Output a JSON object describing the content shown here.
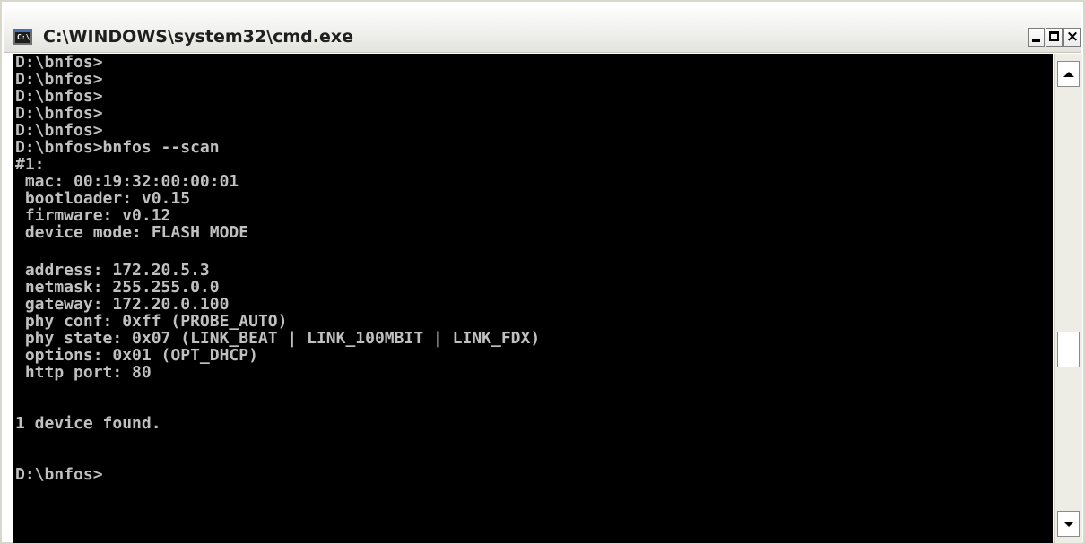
{
  "window": {
    "title": "C:\\WINDOWS\\system32\\cmd.exe",
    "icon_text": "C:\\",
    "icons": {
      "app": "cmd-icon",
      "minimize": "minimize-icon",
      "maximize": "maximize-icon",
      "close": "close-icon",
      "scroll_up": "scroll-up-arrow-icon",
      "scroll_down": "scroll-down-arrow-icon"
    },
    "close_glyph": "×"
  },
  "console": {
    "background_color": "#000000",
    "text_color": "#c0c0c0",
    "lines": [
      "D:\\bnfos>",
      "D:\\bnfos>",
      "D:\\bnfos>",
      "D:\\bnfos>",
      "D:\\bnfos>",
      "D:\\bnfos>bnfos --scan",
      "#1:",
      " mac: 00:19:32:00:00:01",
      " bootloader: v0.15",
      " firmware: v0.12",
      " device mode: FLASH MODE",
      "",
      " address: 172.20.5.3",
      " netmask: 255.255.0.0",
      " gateway: 172.20.0.100",
      " phy conf: 0xff (PROBE_AUTO)",
      " phy state: 0x07 (LINK_BEAT | LINK_100MBIT | LINK_FDX)",
      " options: 0x01 (OPT_DHCP)",
      " http port: 80",
      "",
      "",
      "1 device found.",
      "",
      "",
      "D:\\bnfos>"
    ]
  }
}
